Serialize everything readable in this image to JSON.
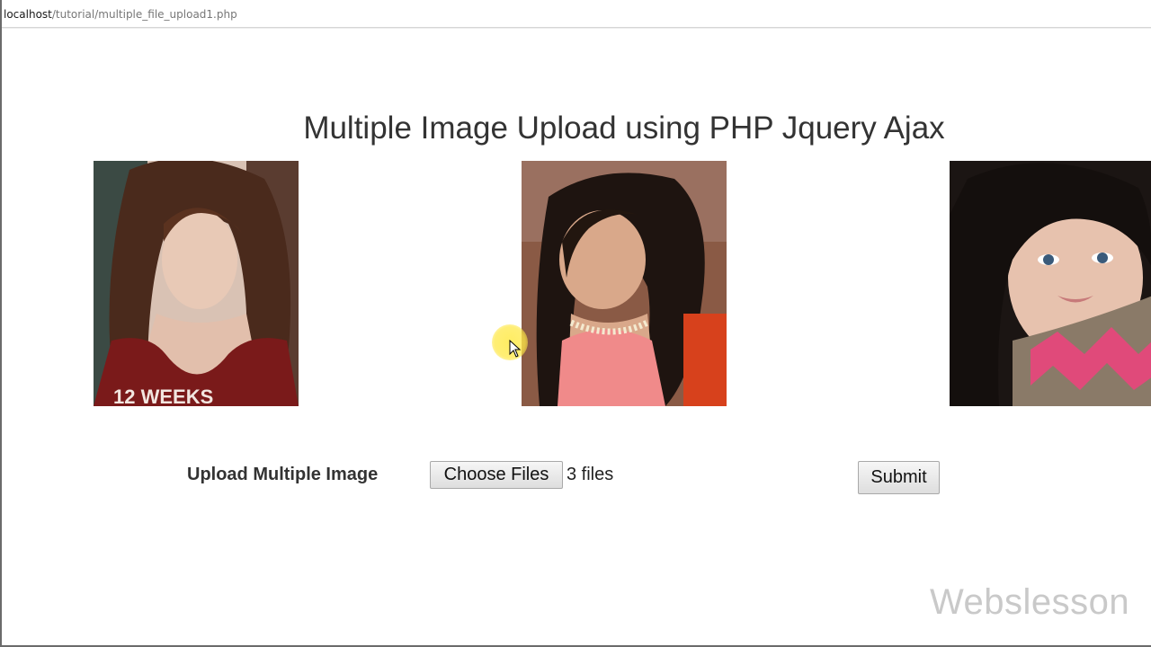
{
  "browser": {
    "url_host": "localhost",
    "url_path": "/tutorial/multiple_file_upload1.php"
  },
  "page": {
    "title": "Multiple Image Upload using PHP Jquery Ajax"
  },
  "gallery": {
    "images": [
      {
        "name": "uploaded-image-1",
        "shirt_text": "12 WEEKS"
      },
      {
        "name": "uploaded-image-2"
      },
      {
        "name": "uploaded-image-3"
      }
    ]
  },
  "form": {
    "label": "Upload Multiple Image",
    "choose_files_label": "Choose Files",
    "file_status": "3 files",
    "submit_label": "Submit"
  },
  "watermark": {
    "text": "Webslesson"
  },
  "colors": {
    "text": "#333333",
    "button_border": "#a9a9a9",
    "watermark": "#c9c9c9",
    "cursor_highlight": "#ffe846"
  }
}
